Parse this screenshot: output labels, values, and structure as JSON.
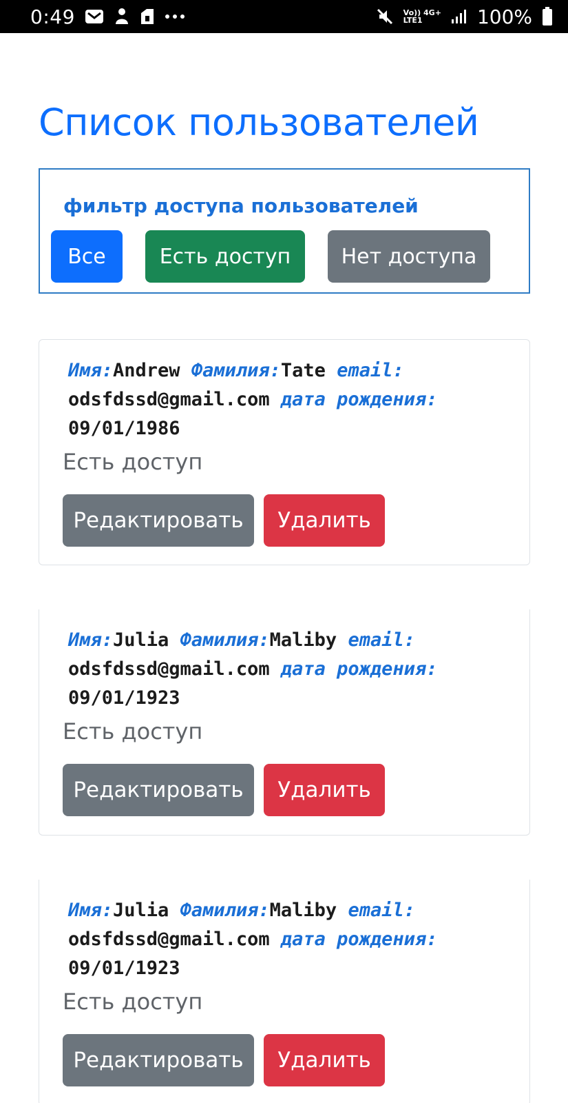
{
  "status_bar": {
    "time": "0:49",
    "left_icons": [
      "mail-icon",
      "app-icon",
      "app-icon-2",
      "more-dots-icon"
    ],
    "network_top": "Vo)) 4G+",
    "network_bottom": "LTE1",
    "battery": "100%"
  },
  "page": {
    "title": "Список пользователей"
  },
  "filter": {
    "label": "фильтр доступа пользователей",
    "buttons": {
      "all": "Все",
      "has_access": "Есть доступ",
      "no_access": "Нет доступа"
    },
    "colors": {
      "all": "#0d6efd",
      "has_access": "#198754",
      "no_access": "#6c757d"
    }
  },
  "labels": {
    "name": "Имя:",
    "surname": "Фамилия:",
    "email": "email:",
    "birth": "дата рождения:",
    "edit": "Редактировать",
    "delete": "Удалить"
  },
  "users": [
    {
      "name": "Andrew",
      "surname": "Tate",
      "email": "odsfdssd@gmail.com",
      "birth": "09/01/1986",
      "access": "Есть доступ"
    },
    {
      "name": "Julia",
      "surname": "Maliby",
      "email": "odsfdssd@gmail.com",
      "birth": "09/01/1923",
      "access": "Есть доступ"
    },
    {
      "name": "Julia",
      "surname": "Maliby",
      "email": "odsfdssd@gmail.com",
      "birth": "09/01/1923",
      "access": "Есть доступ"
    }
  ]
}
